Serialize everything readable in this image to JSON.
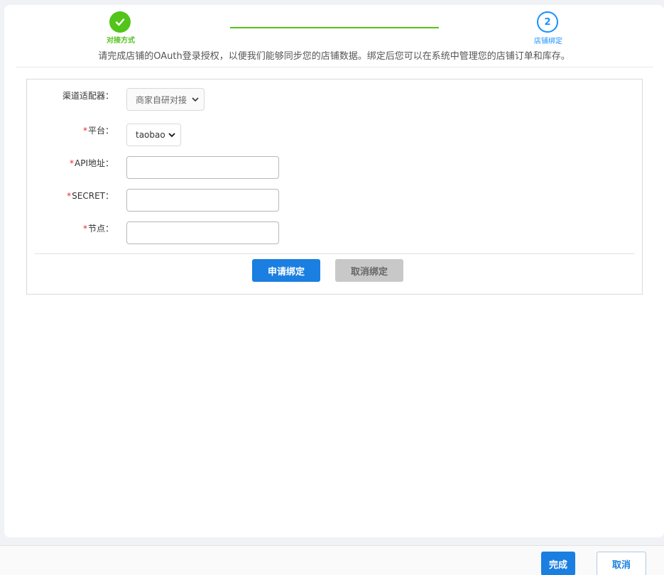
{
  "steps": [
    {
      "label": "对接方式",
      "status": "done",
      "icon": "check-icon"
    },
    {
      "label": "店铺绑定",
      "number": "2",
      "status": "active"
    }
  ],
  "hint": "请完成店铺的OAuth登录授权，以便我们能够同步您的店铺数据。绑定后您可以在系统中管理您的店铺订单和库存。",
  "form": {
    "adapter": {
      "label": "渠道适配器：",
      "value": "商家自研对接"
    },
    "platform": {
      "label": "平台：",
      "required_mark": "*",
      "value": "taobao"
    },
    "api": {
      "label": "API地址：",
      "required_mark": "*",
      "value": ""
    },
    "secret": {
      "label": "SECRET：",
      "required_mark": "*",
      "value": ""
    },
    "node": {
      "label": "节点：",
      "required_mark": "*",
      "value": ""
    },
    "apply_button": "申请绑定",
    "cancel_bind_button": "取消绑定"
  },
  "footer": {
    "done_button": "完成",
    "cancel_button": "取消"
  },
  "colors": {
    "success": "#52c41a",
    "primary": "#1a7fe0",
    "active_step": "#1890ff",
    "required": "#f5222d",
    "disabled": "#c8c8c8"
  }
}
